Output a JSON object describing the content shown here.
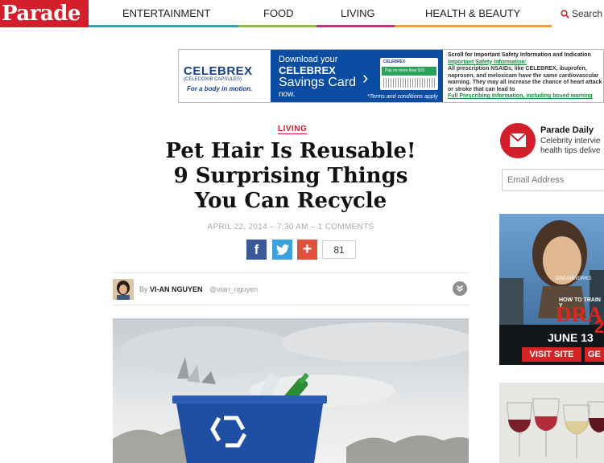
{
  "header": {
    "logo": "Parade",
    "nav": [
      {
        "label": "ENTERTAINMENT",
        "color": "#2ea7b5"
      },
      {
        "label": "FOOD",
        "color": "#8cbf3f"
      },
      {
        "label": "LIVING",
        "color": "#c8327c"
      },
      {
        "label": "HEALTH & BEAUTY",
        "color": "#f0a12c"
      }
    ],
    "search_label": "Search"
  },
  "ad_banner": {
    "brand": "CELEBREX",
    "brand_sub": "(CELECOXIB CAPSULES)",
    "tagline": "For a body in motion.",
    "download": "Download your",
    "card_brand": "CELEBREX",
    "savings": "Savings Card",
    "now": "now.",
    "terms": "*Terms and conditions apply",
    "card_title": "CELEBREX",
    "card_pay": "Pay no more than $15",
    "safety_heading": "Scroll for Important Safety Information and Indication",
    "safety_link": "Important Safety Information:",
    "safety_body": "All prescription NSAIDs, like CELEBREX, ibuprofen, naproxen, and meloxicam have the same cardiovascular warning. They may all increase the chance of heart attack or stroke that can lead to",
    "full_prescribing": "Full Prescribing Information, including boxed warning"
  },
  "article": {
    "category": "LIVING",
    "title": "Pet Hair Is Reusable! 9 Surprising Things You Can Recycle",
    "meta": "APRIL 22, 2014 – 7:30 AM – 1 COMMENTS",
    "share_count": "81",
    "byline_prefix": "By",
    "author": "VI-AN NGUYEN",
    "handle": "@vian_nguyen"
  },
  "sidebar": {
    "daily_title": "Parade Daily",
    "daily_desc_1": "Celebrity intervie",
    "daily_desc_2": "health tips delive",
    "email_placeholder": "Email Address",
    "movie_ad": {
      "presenter": "DREAMWORKS",
      "tagline": "HOW TO TRAIN Y",
      "title": "DRAG",
      "number": "2",
      "date": "JUNE 13",
      "cta": "VISIT SITE",
      "cta2": "GE"
    }
  },
  "icons": {
    "search": "search-icon",
    "facebook": "facebook-icon",
    "twitter": "twitter-icon",
    "plus": "plus-icon",
    "expand": "chevron-down-icon",
    "newsletter": "envelope-icon"
  },
  "colors": {
    "brand_red": "#d21f2b",
    "facebook": "#3b5998",
    "twitter": "#3aa1dd",
    "plus": "#e1523c"
  }
}
